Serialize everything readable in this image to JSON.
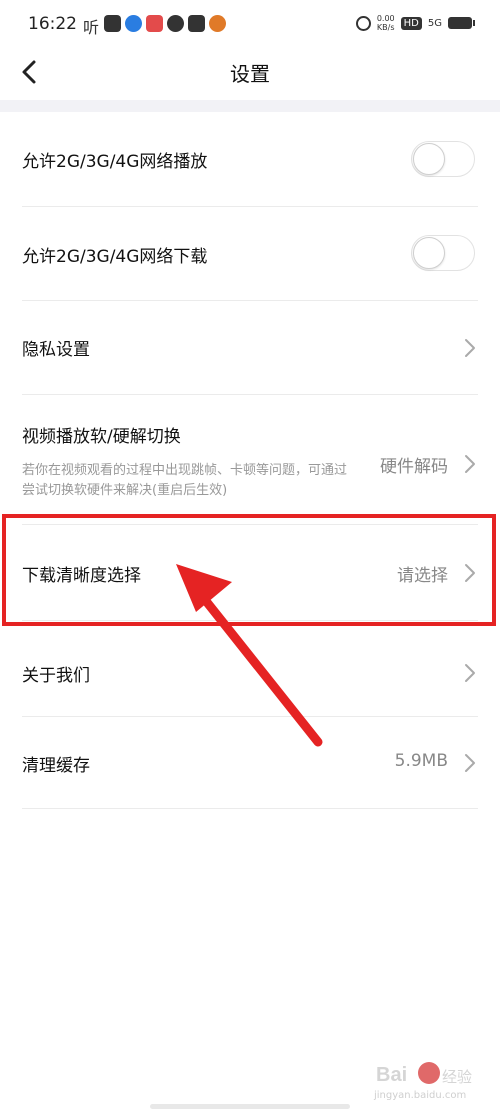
{
  "status_bar": {
    "time": "16:22",
    "ting_glyph": "听",
    "speed_value": "0.00",
    "speed_unit": "KB/s",
    "hd": "HD",
    "network": "5G"
  },
  "nav": {
    "title": "设置",
    "back_icon": "chevron-left-icon"
  },
  "settings": [
    {
      "label": "允许2G/3G/4G网络播放",
      "type": "toggle",
      "on": false
    },
    {
      "label": "允许2G/3G/4G网络下载",
      "type": "toggle",
      "on": false
    },
    {
      "label": "隐私设置",
      "type": "link"
    },
    {
      "label": "视频播放软/硬解切换",
      "type": "link",
      "value": "硬件解码",
      "description": "若你在视频观看的过程中出现跳帧、卡顿等问题，可通过尝试切换软硬件来解决(重启后生效)"
    },
    {
      "label": "下载清晰度选择",
      "type": "link",
      "value": "请选择"
    },
    {
      "label": "关于我们",
      "type": "link"
    },
    {
      "label": "清理缓存",
      "type": "link",
      "value": "5.9MB"
    }
  ],
  "annotation": {
    "highlight_color": "#e52323"
  },
  "watermark": {
    "brand": "Bai",
    "brand_cn": "经验",
    "url": "jingyan.baidu.com"
  }
}
